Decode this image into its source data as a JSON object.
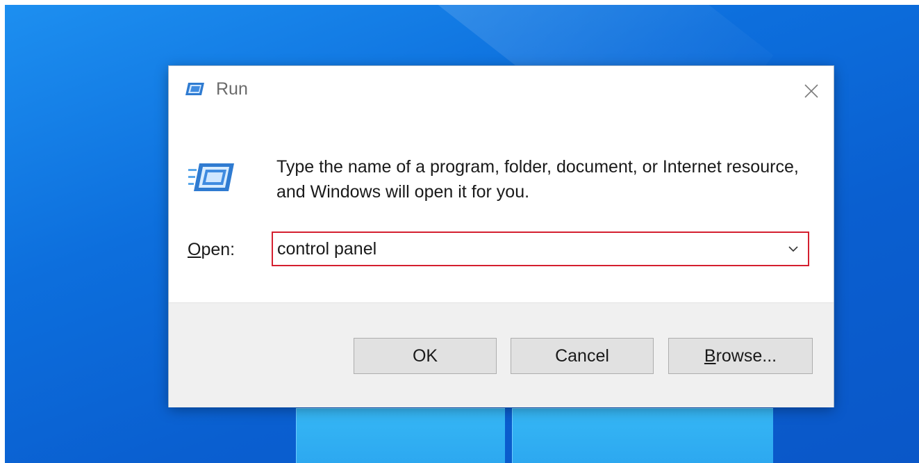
{
  "dialog": {
    "title": "Run",
    "description": "Type the name of a program, folder, document, or Internet resource, and Windows will open it for you.",
    "open_label_accel": "O",
    "open_label_rest": "pen:",
    "open_value": "control panel",
    "buttons": {
      "ok": "OK",
      "cancel": "Cancel",
      "browse_accel": "B",
      "browse_rest": "rowse..."
    }
  },
  "icons": {
    "title": "run-icon",
    "body": "run-icon",
    "close": "close-icon",
    "dropdown": "chevron-down-icon"
  },
  "colors": {
    "highlight": "#d41f2f",
    "desktop": "#0a5fd0"
  }
}
